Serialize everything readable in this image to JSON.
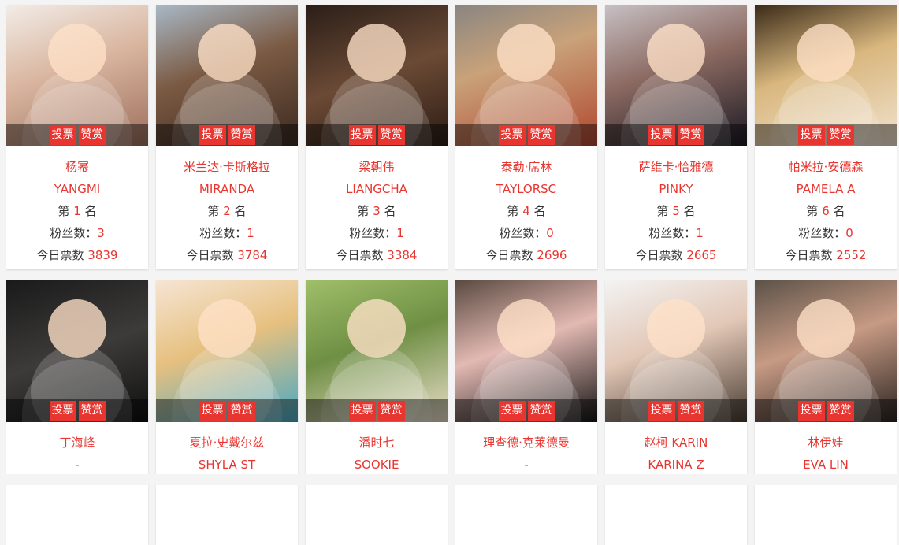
{
  "buttons": {
    "vote": "投票",
    "reward": "赞赏"
  },
  "labels": {
    "rank_prefix": "第",
    "rank_suffix": "名",
    "fans": "粉丝数：",
    "votes": "今日票数"
  },
  "accent_color": "#e8352f",
  "cards": [
    {
      "cn_name": "杨幂",
      "en_name": "YANGMI",
      "rank": "1",
      "fans": "3",
      "votes": "3839"
    },
    {
      "cn_name": "米兰达·卡斯格拉",
      "en_name": "MIRANDA",
      "rank": "2",
      "fans": "1",
      "votes": "3784"
    },
    {
      "cn_name": "梁朝伟",
      "en_name": "LIANGCHA",
      "rank": "3",
      "fans": "1",
      "votes": "3384"
    },
    {
      "cn_name": "泰勒·席林",
      "en_name": "TAYLORSC",
      "rank": "4",
      "fans": "0",
      "votes": "2696"
    },
    {
      "cn_name": "萨维卡·恰雅德",
      "en_name": "PINKY",
      "rank": "5",
      "fans": "1",
      "votes": "2665"
    },
    {
      "cn_name": "帕米拉·安德森",
      "en_name": "PAMELA A",
      "rank": "6",
      "fans": "0",
      "votes": "2552"
    },
    {
      "cn_name": "丁海峰",
      "en_name": "-"
    },
    {
      "cn_name": "夏拉·史戴尔兹",
      "en_name": "SHYLA ST"
    },
    {
      "cn_name": "潘时七",
      "en_name": "SOOKIE"
    },
    {
      "cn_name": "理查德·克莱德曼",
      "en_name": "-"
    },
    {
      "cn_name": "赵柯 KARIN",
      "en_name": "KARINA Z"
    },
    {
      "cn_name": "林伊娃",
      "en_name": "EVA LIN"
    }
  ]
}
